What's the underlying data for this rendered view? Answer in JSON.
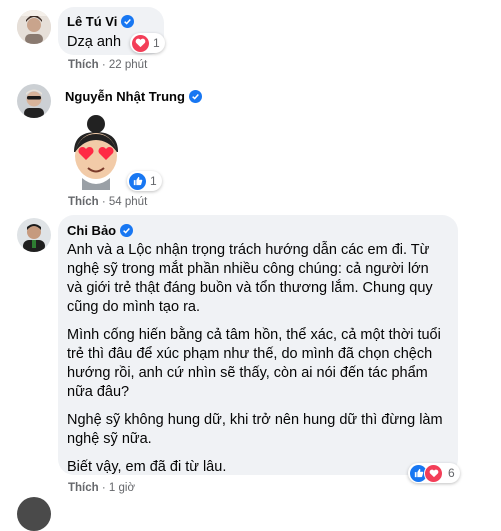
{
  "comments": [
    {
      "author": "Lê Tú Vi",
      "text": "Dzạ anh",
      "reaction_count": "1",
      "reaction_icon": "love-icon",
      "action": "Thích",
      "time": "22 phút"
    },
    {
      "author": "Nguyễn Nhật Trung",
      "sticker": "avatar-sticker-heart-eyes",
      "reaction_count": "1",
      "reaction_icon": "like-icon",
      "action": "Thích",
      "time": "54 phút"
    },
    {
      "author": "Chi Bảo",
      "paragraphs": [
        "Anh và a Lộc nhận trọng trách hướng dẫn các em đi. Từ nghệ sỹ trong mắt phần nhiều công chúng: cả người lớn và giới trẻ thật đáng buồn và tổn thương lắm. Chung quy cũng do mình tạo ra.",
        "Mình cống hiến bằng cả tâm hồn, thể xác, cả một thời tuổi trẻ thì đâu để xúc phạm như thế, do mình đã chọn chệch hướng rồi, anh cứ nhìn sẽ thấy, còn ai nói đến tác phẩm nữa đâu?",
        "Nghệ sỹ không hung dữ, khi trở nên hung dữ thì đừng làm nghệ sỹ nữa.",
        "Biết vậy, em đã đi từ lâu."
      ],
      "reaction_count": "6",
      "reaction_icons": [
        "like-icon",
        "love-icon"
      ],
      "action": "Thích",
      "time": "1 giờ"
    }
  ],
  "colors": {
    "bubble": "#f0f2f5",
    "verified": "#1877f2",
    "like": "#1877f2",
    "love": "#f33e58",
    "meta": "#65676b"
  }
}
